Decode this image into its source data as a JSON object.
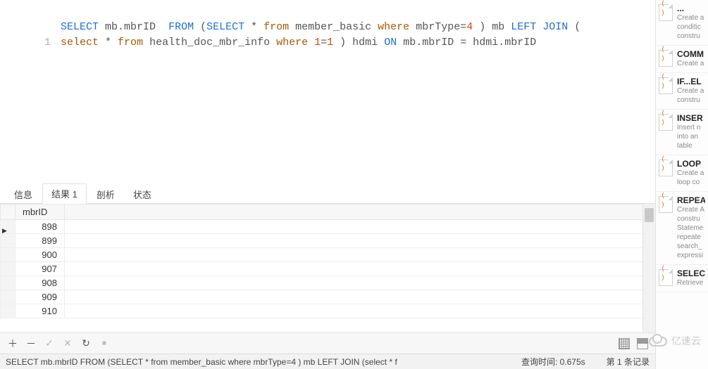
{
  "editor": {
    "line_number": "1",
    "sql": {
      "line1": {
        "t1": "SELECT",
        "t2": " mb.mbrID  ",
        "t3": "FROM",
        "t4": " (",
        "t5": "SELECT",
        "t6": " * ",
        "t7": "from",
        "t8": " member_basic ",
        "t9": "where",
        "t10": " mbrType=",
        "t11": "4",
        "t12": " ) mb ",
        "t13": "LEFT",
        "t14": " ",
        "t15": "JOIN",
        "t16": " ("
      },
      "line2": {
        "t1": "select",
        "t2": " * ",
        "t3": "from",
        "t4": " health_doc_mbr_info ",
        "t5": "where",
        "t6": " ",
        "t7": "1",
        "t8": "=",
        "t9": "1",
        "t10": " ) hdmi ",
        "t11": "ON",
        "t12": " mb.mbrID = hdmi.mbrID"
      }
    }
  },
  "tabs": {
    "info": "信息",
    "result": "结果 1",
    "profile": "剖析",
    "status": "状态"
  },
  "grid": {
    "header": "mbrID",
    "rows": [
      "898",
      "899",
      "900",
      "907",
      "908",
      "909",
      "910"
    ]
  },
  "toolbar": {
    "add": "＋",
    "remove": "－",
    "check": "✓",
    "cancel": "✕",
    "refresh": "↻",
    "stop": "■"
  },
  "statusbar": {
    "query": "SELECT mb.mbrID  FROM (SELECT * from member_basic where mbrType=4 ) mb LEFT JOIN (select * f",
    "time_label": "查询时间:",
    "time_value": "0.675s",
    "record": "第 1 条记录"
  },
  "snippets": [
    {
      "title": "...",
      "desc": "Create a conditic constru"
    },
    {
      "title": "COMM",
      "desc": "Create a"
    },
    {
      "title": "IF...EL",
      "desc": "Create a constru"
    },
    {
      "title": "INSER",
      "desc": "Insert n into an table"
    },
    {
      "title": "LOOP",
      "desc": "Create a loop co"
    },
    {
      "title": "REPEA",
      "desc": "Create A constru Stateme repeate search_ expressi"
    },
    {
      "title": "SELEC",
      "desc": "Retrieve"
    }
  ],
  "watermark": "亿速云"
}
